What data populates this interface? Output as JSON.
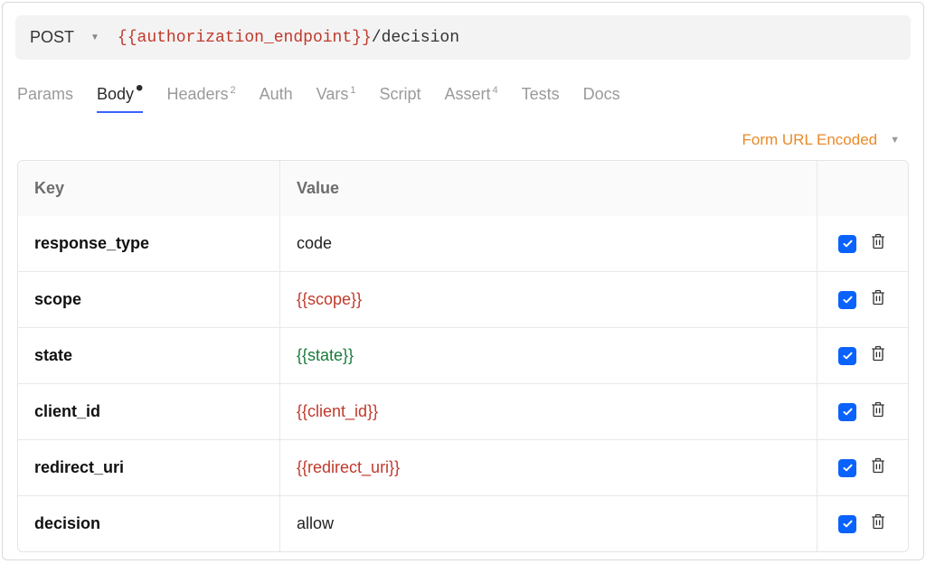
{
  "request": {
    "method": "POST",
    "url_var": "{{authorization_endpoint}}",
    "url_path": "/decision"
  },
  "tabs": [
    {
      "label": "Params",
      "badge": "",
      "active": false
    },
    {
      "label": "Body",
      "badge": "•",
      "active": true
    },
    {
      "label": "Headers",
      "badge": "2",
      "active": false
    },
    {
      "label": "Auth",
      "badge": "",
      "active": false
    },
    {
      "label": "Vars",
      "badge": "1",
      "active": false
    },
    {
      "label": "Script",
      "badge": "",
      "active": false
    },
    {
      "label": "Assert",
      "badge": "4",
      "active": false
    },
    {
      "label": "Tests",
      "badge": "",
      "active": false
    },
    {
      "label": "Docs",
      "badge": "",
      "active": false
    }
  ],
  "body_encoding": "Form URL Encoded",
  "table": {
    "headers": {
      "key": "Key",
      "value": "Value"
    },
    "rows": [
      {
        "key": "response_type",
        "value": "code",
        "value_style": "plain",
        "enabled": true
      },
      {
        "key": "scope",
        "value": "{{scope}}",
        "value_style": "red",
        "enabled": true
      },
      {
        "key": "state",
        "value": "{{state}}",
        "value_style": "green",
        "enabled": true
      },
      {
        "key": "client_id",
        "value": "{{client_id}}",
        "value_style": "red",
        "enabled": true
      },
      {
        "key": "redirect_uri",
        "value": "{{redirect_uri}}",
        "value_style": "red",
        "enabled": true
      },
      {
        "key": "decision",
        "value": "allow",
        "value_style": "plain",
        "enabled": true
      }
    ]
  }
}
